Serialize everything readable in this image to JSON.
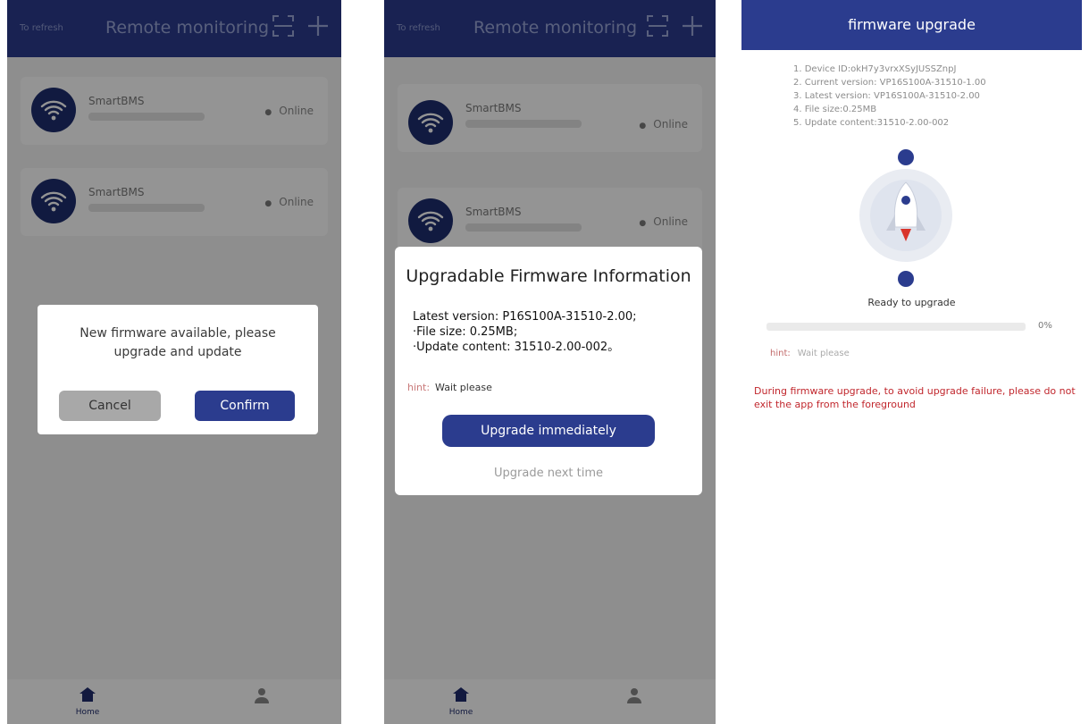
{
  "colors": {
    "primary": "#2b3c8e",
    "overlay": "rgba(0,0,0,0.42)",
    "warning": "#c1272d"
  },
  "screen1": {
    "header": {
      "refresh_label": "To refresh",
      "title": "Remote monitoring",
      "scan_icon": "scan-icon",
      "add_icon": "plus-icon"
    },
    "devices": [
      {
        "name": "SmartBMS",
        "status": "Online",
        "icon": "wifi-icon"
      },
      {
        "name": "SmartBMS",
        "status": "Online",
        "icon": "wifi-icon"
      }
    ],
    "dialog": {
      "message": "New firmware available, please upgrade and update",
      "cancel_label": "Cancel",
      "confirm_label": "Confirm"
    },
    "tabbar": {
      "home_label": "Home",
      "home_icon": "home-icon",
      "mine_icon": "user-icon"
    }
  },
  "screen2": {
    "header": {
      "refresh_label": "To refresh",
      "title": "Remote monitoring",
      "scan_icon": "scan-icon",
      "add_icon": "plus-icon"
    },
    "devices": [
      {
        "name": "SmartBMS",
        "status": "Online",
        "icon": "wifi-icon"
      },
      {
        "name": "SmartBMS",
        "status": "Online",
        "icon": "wifi-icon"
      }
    ],
    "dialog": {
      "title": "Upgradable Firmware Information",
      "latest_version": "Latest version:  P16S100A-31510-2.00;",
      "file_size": "·File size:  0.25MB;",
      "update_content": "·Update content:  31510-2.00-002。",
      "hint_label": "hint:",
      "hint_value": "Wait please",
      "upgrade_button": "Upgrade immediately",
      "next_time": "Upgrade next time"
    },
    "tabbar": {
      "home_label": "Home",
      "home_icon": "home-icon",
      "mine_icon": "user-icon"
    }
  },
  "screen3": {
    "title": "firmware upgrade",
    "info": [
      "1. Device ID:okH7y3vrxXSyJUSSZnpJ",
      "2. Current version: VP16S100A-31510-1.00",
      "3. Latest version: VP16S100A-31510-2.00",
      "4. File size:0.25MB",
      "5. Update content:31510-2.00-002"
    ],
    "rocket_icon": "rocket-icon",
    "status": "Ready to upgrade",
    "progress_percent": 0,
    "progress_label": "0%",
    "hint_label": "hint:",
    "hint_value": "Wait please",
    "warning": "During firmware upgrade, to avoid upgrade failure, please do not exit the app from the foreground"
  }
}
